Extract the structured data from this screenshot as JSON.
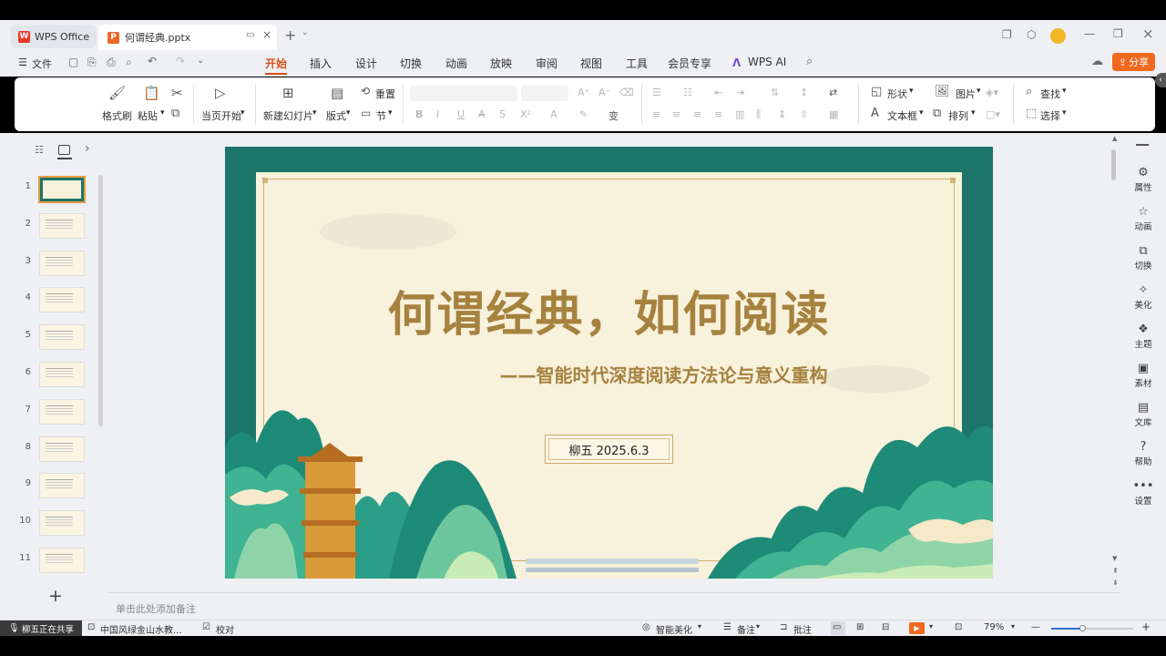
{
  "titlebar": {
    "app_tab": "WPS Office",
    "doc_tab": "何谓经典.pptx",
    "logo_letter": "W",
    "ppt_letter": "P"
  },
  "menu": {
    "file": "文件",
    "tabs": [
      "开始",
      "插入",
      "设计",
      "切换",
      "动画",
      "放映",
      "审阅",
      "视图",
      "工具",
      "会员专享",
      "WPS AI"
    ],
    "share": "分享"
  },
  "ribbon": {
    "format_painter": "格式刷",
    "paste": "粘贴",
    "start_from_current": "当页开始",
    "new_slide": "新建幻灯片",
    "layout": "版式",
    "reset": "重置",
    "section": "节",
    "shape": "形状",
    "picture": "图片",
    "textbox": "文本框",
    "arrange": "排列",
    "find": "查找",
    "select": "选择"
  },
  "thumbnails": [
    "1",
    "2",
    "3",
    "4",
    "5",
    "6",
    "7",
    "8",
    "9",
    "10",
    "11"
  ],
  "slide": {
    "title": "何谓经典，如何阅读",
    "subtitle": "——智能时代深度阅读方法论与意义重构",
    "author_date": "柳五  2025.6.3"
  },
  "notes_placeholder": "单击此处添加备注",
  "right_panel": [
    "属性",
    "动画",
    "切换",
    "美化",
    "主题",
    "素材",
    "文库",
    "帮助",
    "设置"
  ],
  "status": {
    "sharing": "柳五正在共享",
    "template": "中国风绿金山水教...",
    "proofread": "校对",
    "smart_beautify": "智能美化",
    "notes": "备注",
    "comments": "批注",
    "zoom": "79%"
  },
  "colors": {
    "accent": "#d9531e",
    "slide_border": "#1c7568",
    "title_gold": "#a6823f"
  }
}
